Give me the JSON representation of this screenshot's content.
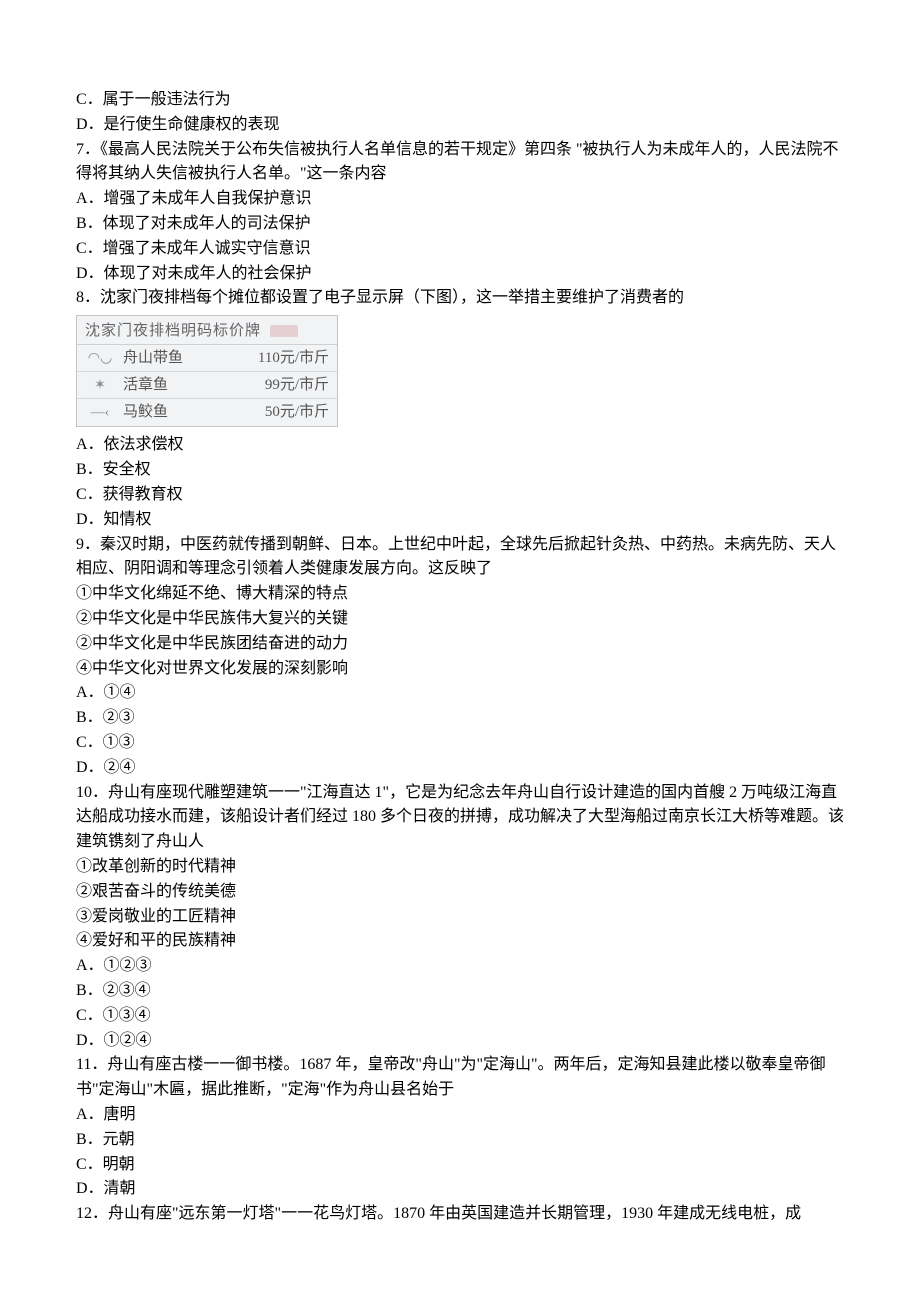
{
  "q6": {
    "c": "C．属于一般违法行为",
    "d": "D．是行使生命健康权的表现"
  },
  "q7": {
    "stem": "7．《最高人民法院关于公布失信被执行人名单信息的若干规定》第四条 \"被执行人为未成年人的，人民法院不得将其纳人失信被执行人名单。\"这一条内容",
    "a": "A．增强了未成年人自我保护意识",
    "b": "B．体现了对未成年人的司法保护",
    "c": "C．增强了未成年人诚实守信意识",
    "d": "D．体现了对未成年人的社会保护"
  },
  "q8": {
    "stem": "8．沈家门夜排档每个摊位都设置了电子显示屏（下图），这一举措主要维护了消费者的",
    "card": {
      "title": "沈家门夜排档明码标价牌",
      "rows": [
        {
          "icon": "fish-icon",
          "name": "舟山带鱼",
          "price": "110元/市斤"
        },
        {
          "icon": "octopus-icon",
          "name": "活章鱼",
          "price": "99元/市斤"
        },
        {
          "icon": "shark-icon",
          "name": "马鲛鱼",
          "price": "50元/市斤"
        }
      ]
    },
    "a": "A．依法求偿权",
    "b": "B．安全权",
    "c": "C．获得教育权",
    "d": "D．知情权"
  },
  "q9": {
    "stem": "9．秦汉时期，中医药就传播到朝鲜、日本。上世纪中叶起，全球先后掀起针灸热、中药热。未病先防、天人相应、阴阳调和等理念引领着人类健康发展方向。这反映了",
    "s1": "①中华文化绵延不绝、博大精深的特点",
    "s2": "②中华文化是中华民族伟大复兴的关键",
    "s3": "②中华文化是中华民族团结奋进的动力",
    "s4": "④中华文化对世界文化发展的深刻影响",
    "a": "A．①④",
    "b": "B．②③",
    "c": "C．①③",
    "d": "D．②④"
  },
  "q10": {
    "stem": "10．舟山有座现代雕塑建筑一一\"江海直达 1\"，它是为纪念去年舟山自行设计建造的国内首艘 2 万吨级江海直达船成功接水而建，该船设计者们经过 180 多个日夜的拼搏，成功解决了大型海船过南京长江大桥等难题。该建筑镌刻了舟山人",
    "s1": "①改革创新的时代精神",
    "s2": "②艰苦奋斗的传统美德",
    "s3": "③爱岗敬业的工匠精神",
    "s4": "④爱好和平的民族精神",
    "a": "A．①②③",
    "b": "B．②③④",
    "c": "C．①③④",
    "d": "D．①②④"
  },
  "q11": {
    "stem": "11．舟山有座古楼一一御书楼。1687 年，皇帝改\"舟山\"为\"定海山\"。两年后，定海知县建此楼以敬奉皇帝御书\"定海山\"木匾，据此推断，\"定海\"作为舟山县名始于",
    "a": "A．唐明",
    "b": "B．元朝",
    "c": "C．明朝",
    "d": "D．清朝"
  },
  "q12": {
    "stem": "12．舟山有座\"远东第一灯塔\"一一花鸟灯塔。1870 年由英国建造并长期管理，1930 年建成无线电桩，成"
  }
}
